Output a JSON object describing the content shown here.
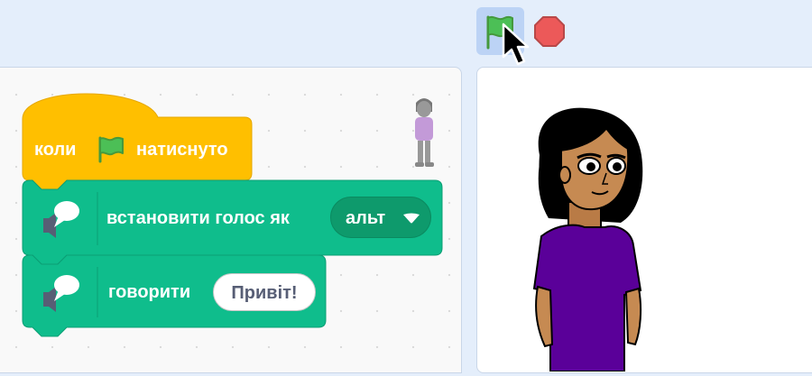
{
  "toolbar": {
    "green_flag_icon": "green-flag-icon",
    "stop_icon": "stop-icon"
  },
  "blocks": {
    "event": {
      "prefix": "коли",
      "suffix": "натиснуто",
      "color": "#ffbf00"
    },
    "set_voice": {
      "label": "встановити голос як",
      "dropdown_value": "альт",
      "color": "#0fbd8c"
    },
    "speak": {
      "label": "говорити",
      "input_value": "Привіт!",
      "color": "#0fbd8c"
    }
  },
  "colors": {
    "event": "#ffbf00",
    "extension": "#0fbd8c",
    "extension_dark": "#0b9e74",
    "stop": "#ec5959",
    "flag": "#4cbf56"
  }
}
